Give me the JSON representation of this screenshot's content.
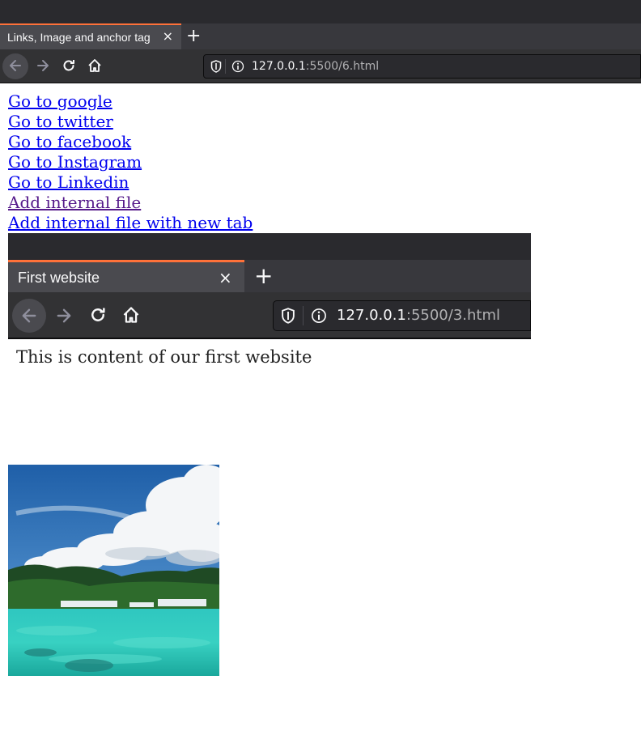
{
  "browser": {
    "tab_title": "Links, Image and anchor tag",
    "tab_close": "×",
    "new_tab": "+",
    "url_host": "127.0.0.1",
    "url_rest": ":5500/6.html",
    "accent_color": "#ff7139"
  },
  "links": [
    {
      "label": "Go to google",
      "visited": false
    },
    {
      "label": "Go to twitter",
      "visited": false
    },
    {
      "label": "Go to facebook",
      "visited": false
    },
    {
      "label": "Go to Instagram",
      "visited": false
    },
    {
      "label": "Go to Linkedin",
      "visited": false
    },
    {
      "label": "Add internal file",
      "visited": true
    },
    {
      "label": "Add internal file with new tab",
      "visited": false
    }
  ],
  "embedded_screenshot": {
    "tab_title": "First website",
    "tab_close": "×",
    "new_tab": "+",
    "url_host": "127.0.0.1",
    "url_rest": ":5500/3.html",
    "content_text": "This is content of our first website"
  },
  "image": {
    "subject": "tropical-beach-photo"
  }
}
